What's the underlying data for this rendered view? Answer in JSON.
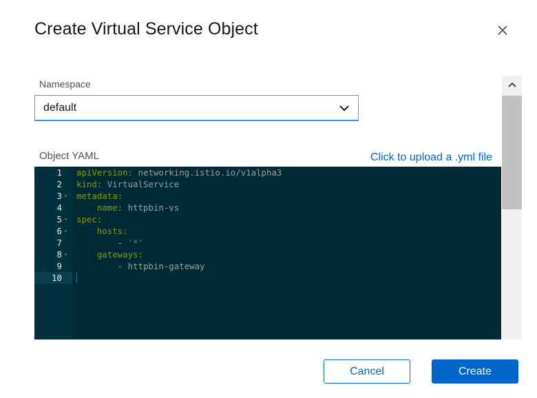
{
  "dialog": {
    "title": "Create Virtual Service Object",
    "close_icon": "close-icon"
  },
  "namespace": {
    "label": "Namespace",
    "value": "default",
    "icon": "chevron-down-icon"
  },
  "yaml": {
    "label": "Object YAML",
    "upload_link": "Click to upload a .yml file"
  },
  "editor": {
    "theme": "solarized-dark",
    "lines": [
      {
        "num": "1",
        "text": "apiVersion: networking.istio.io/v1alpha3"
      },
      {
        "num": "2",
        "text": "kind: VirtualService"
      },
      {
        "num": "3",
        "text": "metadata:"
      },
      {
        "num": "4",
        "text": "    name: httpbin-vs"
      },
      {
        "num": "5",
        "text": "spec:"
      },
      {
        "num": "6",
        "text": "    hosts:"
      },
      {
        "num": "7",
        "text": "        - '*'"
      },
      {
        "num": "8",
        "text": "    gateways:"
      },
      {
        "num": "9",
        "text": "        - httpbin-gateway"
      },
      {
        "num": "10",
        "text": ""
      }
    ]
  },
  "buttons": {
    "cancel": "Cancel",
    "create": "Create"
  },
  "colors": {
    "primary": "#0066cc",
    "editor_bg": "#002b36",
    "yaml_key": "#859900",
    "yaml_value": "#93a1a1",
    "yaml_string": "#2aa198"
  }
}
